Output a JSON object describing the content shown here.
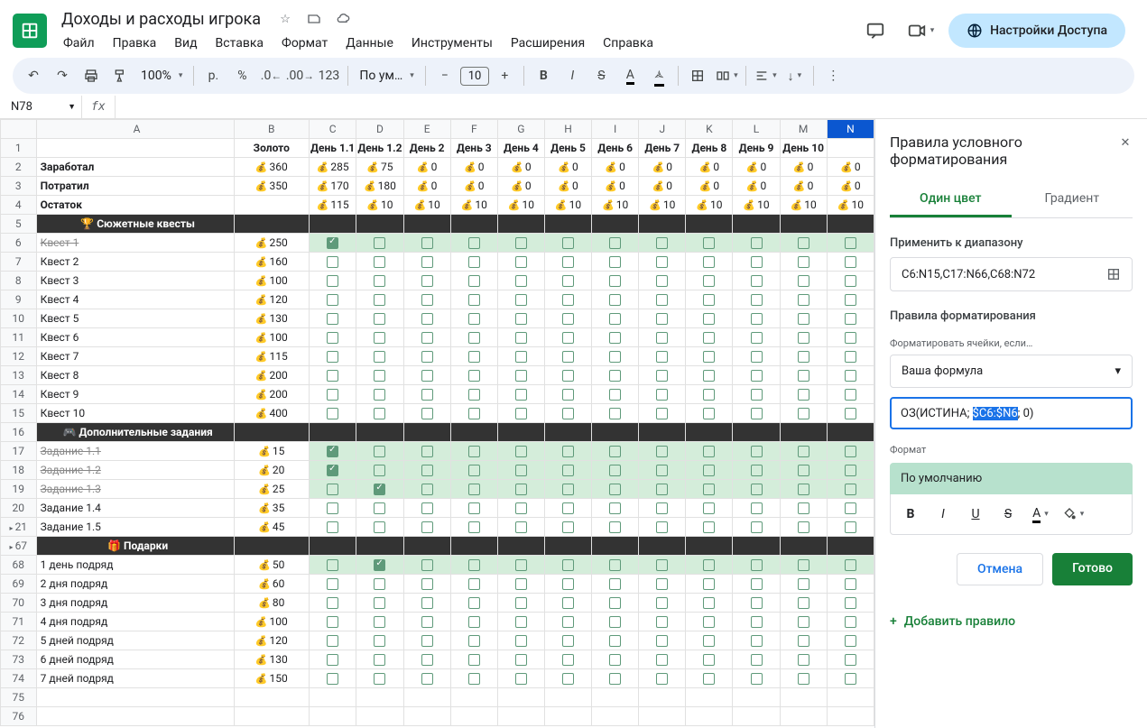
{
  "doc_title": "Доходы и расходы игрока",
  "menu": [
    "Файл",
    "Правка",
    "Вид",
    "Вставка",
    "Формат",
    "Данные",
    "Инструменты",
    "Расширения",
    "Справка"
  ],
  "share_label": "Настройки Доступа",
  "toolbar": {
    "zoom": "100%",
    "currency": "р.",
    "percent": "%",
    "font": "По ум…",
    "f_size": "10",
    "num_fmt": "123"
  },
  "name_box": "N78",
  "columns": [
    "A",
    "B",
    "C",
    "D",
    "E",
    "F",
    "G",
    "H",
    "I",
    "J",
    "K",
    "L",
    "M",
    "N"
  ],
  "col_labels": {
    "B": "Золото",
    "C": "День 1.1",
    "D": "День 1.2",
    "E": "День 2",
    "F": "День 3",
    "G": "День 4",
    "H": "День 5",
    "I": "День 6",
    "J": "День 7",
    "K": "День 8",
    "L": "День 9",
    "M": "День 10"
  },
  "summary": [
    {
      "n": 2,
      "label": "Заработал",
      "gold": "360",
      "days": [
        "285",
        "75",
        "0",
        "0",
        "0",
        "0",
        "0",
        "0",
        "0",
        "0",
        "0",
        "0"
      ]
    },
    {
      "n": 3,
      "label": "Потратил",
      "gold": "350",
      "days": [
        "170",
        "180",
        "0",
        "0",
        "0",
        "0",
        "0",
        "0",
        "0",
        "0",
        "0",
        "0"
      ]
    },
    {
      "n": 4,
      "label": "Остаток",
      "gold": "",
      "days": [
        "115",
        "10",
        "10",
        "10",
        "10",
        "10",
        "10",
        "10",
        "10",
        "10",
        "10",
        "10"
      ]
    }
  ],
  "sections": [
    {
      "n": 5,
      "title": "🏆 Сюжетные квесты",
      "rows": [
        {
          "n": 6,
          "label": "Квест 1",
          "gold": "250",
          "struck": true,
          "green": true,
          "checks": [
            true,
            false,
            false,
            false,
            false,
            false,
            false,
            false,
            false,
            false,
            false,
            false
          ]
        },
        {
          "n": 7,
          "label": "Квест 2",
          "gold": "160",
          "checks": [
            false,
            false,
            false,
            false,
            false,
            false,
            false,
            false,
            false,
            false,
            false,
            false
          ]
        },
        {
          "n": 8,
          "label": "Квест 3",
          "gold": "100",
          "checks": [
            false,
            false,
            false,
            false,
            false,
            false,
            false,
            false,
            false,
            false,
            false,
            false
          ]
        },
        {
          "n": 9,
          "label": "Квест 4",
          "gold": "120",
          "checks": [
            false,
            false,
            false,
            false,
            false,
            false,
            false,
            false,
            false,
            false,
            false,
            false
          ]
        },
        {
          "n": 10,
          "label": "Квест 5",
          "gold": "130",
          "checks": [
            false,
            false,
            false,
            false,
            false,
            false,
            false,
            false,
            false,
            false,
            false,
            false
          ]
        },
        {
          "n": 11,
          "label": "Квест 6",
          "gold": "100",
          "checks": [
            false,
            false,
            false,
            false,
            false,
            false,
            false,
            false,
            false,
            false,
            false,
            false
          ]
        },
        {
          "n": 12,
          "label": "Квест 7",
          "gold": "115",
          "checks": [
            false,
            false,
            false,
            false,
            false,
            false,
            false,
            false,
            false,
            false,
            false,
            false
          ]
        },
        {
          "n": 13,
          "label": "Квест 8",
          "gold": "200",
          "checks": [
            false,
            false,
            false,
            false,
            false,
            false,
            false,
            false,
            false,
            false,
            false,
            false
          ]
        },
        {
          "n": 14,
          "label": "Квест 9",
          "gold": "200",
          "checks": [
            false,
            false,
            false,
            false,
            false,
            false,
            false,
            false,
            false,
            false,
            false,
            false
          ]
        },
        {
          "n": 15,
          "label": "Квест 10",
          "gold": "400",
          "checks": [
            false,
            false,
            false,
            false,
            false,
            false,
            false,
            false,
            false,
            false,
            false,
            false
          ]
        }
      ]
    },
    {
      "n": 16,
      "title": "🎮 Дополнительные задания",
      "rows": [
        {
          "n": 17,
          "label": "Задание 1.1",
          "gold": "15",
          "struck": true,
          "green": true,
          "checks": [
            true,
            false,
            false,
            false,
            false,
            false,
            false,
            false,
            false,
            false,
            false,
            false
          ]
        },
        {
          "n": 18,
          "label": "Задание 1.2",
          "gold": "20",
          "struck": true,
          "green": true,
          "checks": [
            true,
            false,
            false,
            false,
            false,
            false,
            false,
            false,
            false,
            false,
            false,
            false
          ]
        },
        {
          "n": 19,
          "label": "Задание 1.3",
          "gold": "25",
          "struck": true,
          "green": true,
          "checks": [
            false,
            true,
            false,
            false,
            false,
            false,
            false,
            false,
            false,
            false,
            false,
            false
          ]
        },
        {
          "n": 20,
          "label": "Задание 1.4",
          "gold": "35",
          "checks": [
            false,
            false,
            false,
            false,
            false,
            false,
            false,
            false,
            false,
            false,
            false,
            false
          ]
        },
        {
          "n": 21,
          "label": "Задание 1.5",
          "gold": "45",
          "grouped": true,
          "checks": [
            false,
            false,
            false,
            false,
            false,
            false,
            false,
            false,
            false,
            false,
            false,
            false
          ]
        }
      ]
    },
    {
      "n": 67,
      "title": "🎁 Подарки",
      "grouped": true,
      "rows": [
        {
          "n": 68,
          "label": "1 день подряд",
          "gold": "50",
          "green": true,
          "checks": [
            false,
            true,
            false,
            false,
            false,
            false,
            false,
            false,
            false,
            false,
            false,
            false
          ]
        },
        {
          "n": 69,
          "label": "2 дня подряд",
          "gold": "60",
          "checks": [
            false,
            false,
            false,
            false,
            false,
            false,
            false,
            false,
            false,
            false,
            false,
            false
          ]
        },
        {
          "n": 70,
          "label": "3 дня подряд",
          "gold": "80",
          "checks": [
            false,
            false,
            false,
            false,
            false,
            false,
            false,
            false,
            false,
            false,
            false,
            false
          ]
        },
        {
          "n": 71,
          "label": "4 дня подряд",
          "gold": "100",
          "checks": [
            false,
            false,
            false,
            false,
            false,
            false,
            false,
            false,
            false,
            false,
            false,
            false
          ]
        },
        {
          "n": 72,
          "label": "5 дней подряд",
          "gold": "120",
          "checks": [
            false,
            false,
            false,
            false,
            false,
            false,
            false,
            false,
            false,
            false,
            false,
            false
          ]
        },
        {
          "n": 73,
          "label": "6 дней подряд",
          "gold": "130",
          "checks": [
            false,
            false,
            false,
            false,
            false,
            false,
            false,
            false,
            false,
            false,
            false,
            false
          ]
        },
        {
          "n": 74,
          "label": "7 дней подряд",
          "gold": "150",
          "checks": [
            false,
            false,
            false,
            false,
            false,
            false,
            false,
            false,
            false,
            false,
            false,
            false
          ]
        }
      ]
    }
  ],
  "blank_rows": [
    75,
    76
  ],
  "panel": {
    "title": "Правила условного форматирования",
    "tab_single": "Один цвет",
    "tab_gradient": "Градиент",
    "apply_label": "Применить к диапазону",
    "range": "C6:N15,C17:N66,C68:N72",
    "rules_label": "Правила форматирования",
    "format_if_label": "Форматировать ячейки, если…",
    "condition": "Ваша формула",
    "formula_pre": "ОЗ(ИСТИНА; ",
    "formula_sel": "$C6:$N6",
    "formula_post": "; 0)",
    "format_label": "Формат",
    "preview": "По умолчанию",
    "cancel": "Отмена",
    "done": "Готово",
    "add_rule": "Добавить правило"
  }
}
